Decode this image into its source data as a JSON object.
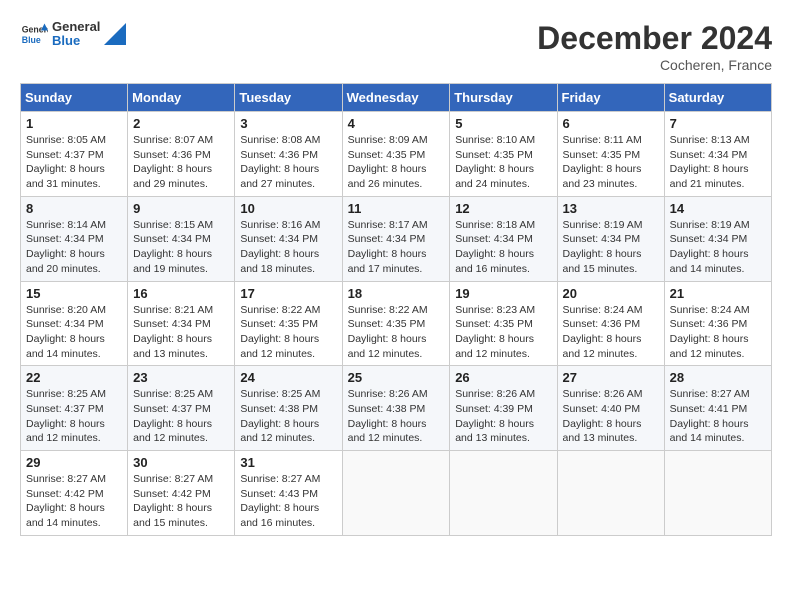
{
  "header": {
    "logo_general": "General",
    "logo_blue": "Blue",
    "month_title": "December 2024",
    "location": "Cocheren, France"
  },
  "weekdays": [
    "Sunday",
    "Monday",
    "Tuesday",
    "Wednesday",
    "Thursday",
    "Friday",
    "Saturday"
  ],
  "weeks": [
    [
      {
        "day": "1",
        "sunrise": "8:05 AM",
        "sunset": "4:37 PM",
        "daylight": "8 hours and 31 minutes."
      },
      {
        "day": "2",
        "sunrise": "8:07 AM",
        "sunset": "4:36 PM",
        "daylight": "8 hours and 29 minutes."
      },
      {
        "day": "3",
        "sunrise": "8:08 AM",
        "sunset": "4:36 PM",
        "daylight": "8 hours and 27 minutes."
      },
      {
        "day": "4",
        "sunrise": "8:09 AM",
        "sunset": "4:35 PM",
        "daylight": "8 hours and 26 minutes."
      },
      {
        "day": "5",
        "sunrise": "8:10 AM",
        "sunset": "4:35 PM",
        "daylight": "8 hours and 24 minutes."
      },
      {
        "day": "6",
        "sunrise": "8:11 AM",
        "sunset": "4:35 PM",
        "daylight": "8 hours and 23 minutes."
      },
      {
        "day": "7",
        "sunrise": "8:13 AM",
        "sunset": "4:34 PM",
        "daylight": "8 hours and 21 minutes."
      }
    ],
    [
      {
        "day": "8",
        "sunrise": "8:14 AM",
        "sunset": "4:34 PM",
        "daylight": "8 hours and 20 minutes."
      },
      {
        "day": "9",
        "sunrise": "8:15 AM",
        "sunset": "4:34 PM",
        "daylight": "8 hours and 19 minutes."
      },
      {
        "day": "10",
        "sunrise": "8:16 AM",
        "sunset": "4:34 PM",
        "daylight": "8 hours and 18 minutes."
      },
      {
        "day": "11",
        "sunrise": "8:17 AM",
        "sunset": "4:34 PM",
        "daylight": "8 hours and 17 minutes."
      },
      {
        "day": "12",
        "sunrise": "8:18 AM",
        "sunset": "4:34 PM",
        "daylight": "8 hours and 16 minutes."
      },
      {
        "day": "13",
        "sunrise": "8:19 AM",
        "sunset": "4:34 PM",
        "daylight": "8 hours and 15 minutes."
      },
      {
        "day": "14",
        "sunrise": "8:19 AM",
        "sunset": "4:34 PM",
        "daylight": "8 hours and 14 minutes."
      }
    ],
    [
      {
        "day": "15",
        "sunrise": "8:20 AM",
        "sunset": "4:34 PM",
        "daylight": "8 hours and 14 minutes."
      },
      {
        "day": "16",
        "sunrise": "8:21 AM",
        "sunset": "4:34 PM",
        "daylight": "8 hours and 13 minutes."
      },
      {
        "day": "17",
        "sunrise": "8:22 AM",
        "sunset": "4:35 PM",
        "daylight": "8 hours and 12 minutes."
      },
      {
        "day": "18",
        "sunrise": "8:22 AM",
        "sunset": "4:35 PM",
        "daylight": "8 hours and 12 minutes."
      },
      {
        "day": "19",
        "sunrise": "8:23 AM",
        "sunset": "4:35 PM",
        "daylight": "8 hours and 12 minutes."
      },
      {
        "day": "20",
        "sunrise": "8:24 AM",
        "sunset": "4:36 PM",
        "daylight": "8 hours and 12 minutes."
      },
      {
        "day": "21",
        "sunrise": "8:24 AM",
        "sunset": "4:36 PM",
        "daylight": "8 hours and 12 minutes."
      }
    ],
    [
      {
        "day": "22",
        "sunrise": "8:25 AM",
        "sunset": "4:37 PM",
        "daylight": "8 hours and 12 minutes."
      },
      {
        "day": "23",
        "sunrise": "8:25 AM",
        "sunset": "4:37 PM",
        "daylight": "8 hours and 12 minutes."
      },
      {
        "day": "24",
        "sunrise": "8:25 AM",
        "sunset": "4:38 PM",
        "daylight": "8 hours and 12 minutes."
      },
      {
        "day": "25",
        "sunrise": "8:26 AM",
        "sunset": "4:38 PM",
        "daylight": "8 hours and 12 minutes."
      },
      {
        "day": "26",
        "sunrise": "8:26 AM",
        "sunset": "4:39 PM",
        "daylight": "8 hours and 13 minutes."
      },
      {
        "day": "27",
        "sunrise": "8:26 AM",
        "sunset": "4:40 PM",
        "daylight": "8 hours and 13 minutes."
      },
      {
        "day": "28",
        "sunrise": "8:27 AM",
        "sunset": "4:41 PM",
        "daylight": "8 hours and 14 minutes."
      }
    ],
    [
      {
        "day": "29",
        "sunrise": "8:27 AM",
        "sunset": "4:42 PM",
        "daylight": "8 hours and 14 minutes."
      },
      {
        "day": "30",
        "sunrise": "8:27 AM",
        "sunset": "4:42 PM",
        "daylight": "8 hours and 15 minutes."
      },
      {
        "day": "31",
        "sunrise": "8:27 AM",
        "sunset": "4:43 PM",
        "daylight": "8 hours and 16 minutes."
      },
      null,
      null,
      null,
      null
    ]
  ],
  "labels": {
    "sunrise": "Sunrise:",
    "sunset": "Sunset:",
    "daylight": "Daylight:"
  }
}
